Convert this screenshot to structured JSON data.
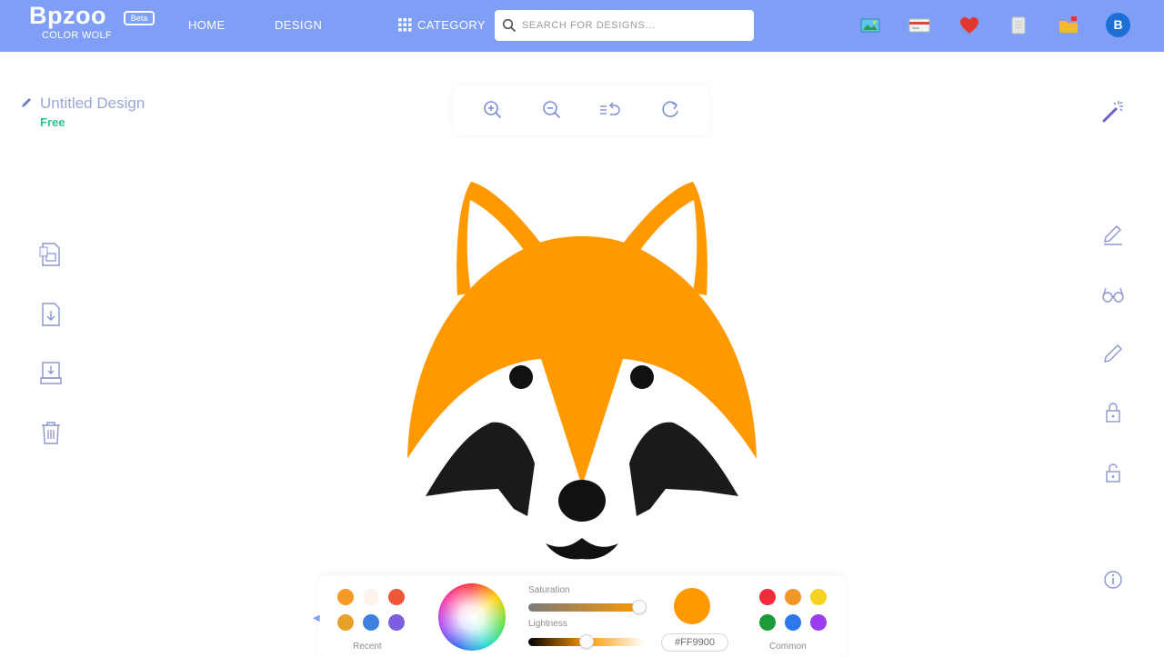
{
  "header": {
    "logo": "Bpzoo",
    "beta_badge": "Beta",
    "subtitle": "COLOR WOLF",
    "nav": {
      "home": "HOME",
      "design": "DESIGN",
      "category": "CATEGORY"
    },
    "search_placeholder": "SEARCH FOR DESIGNS...",
    "avatar_letter": "B",
    "icons": [
      "image-icon",
      "card-icon",
      "heart-icon",
      "document-icon",
      "folder-icon"
    ]
  },
  "design": {
    "title": "Untitled Design",
    "plan": "Free"
  },
  "toolbar": {
    "icons": [
      "zoom-in-icon",
      "zoom-out-icon",
      "undo-icon",
      "redo-icon"
    ]
  },
  "left_tools": {
    "icons": [
      "save-icon",
      "download-icon",
      "export-icon",
      "trash-icon"
    ]
  },
  "right_tools": {
    "icons": [
      "magic-wand-icon",
      "edit-icon",
      "glasses-icon",
      "pen-icon",
      "lock-icon",
      "unlock-icon",
      "info-icon"
    ]
  },
  "artwork": {
    "subject": "fox face",
    "colors": {
      "orange": "#FF9900",
      "black": "#1a1a1a",
      "white": "#ffffff"
    }
  },
  "palette": {
    "recent_label": "Recent",
    "recent_colors": [
      "#F59A23",
      "#FFF4EC",
      "#F1563A",
      "#E8A22C",
      "#3C7FDE",
      "#7B5FE0"
    ],
    "saturation_label": "Saturation",
    "lightness_label": "Lightness",
    "saturation": 1.0,
    "lightness": 0.5,
    "selected_color": "#FF9900",
    "hex_value": "#FF9900",
    "common_label": "Common",
    "common_colors": [
      "#F02C3C",
      "#F2962A",
      "#F6D321",
      "#1F9A3A",
      "#2C78E8",
      "#9A3DF0"
    ]
  }
}
